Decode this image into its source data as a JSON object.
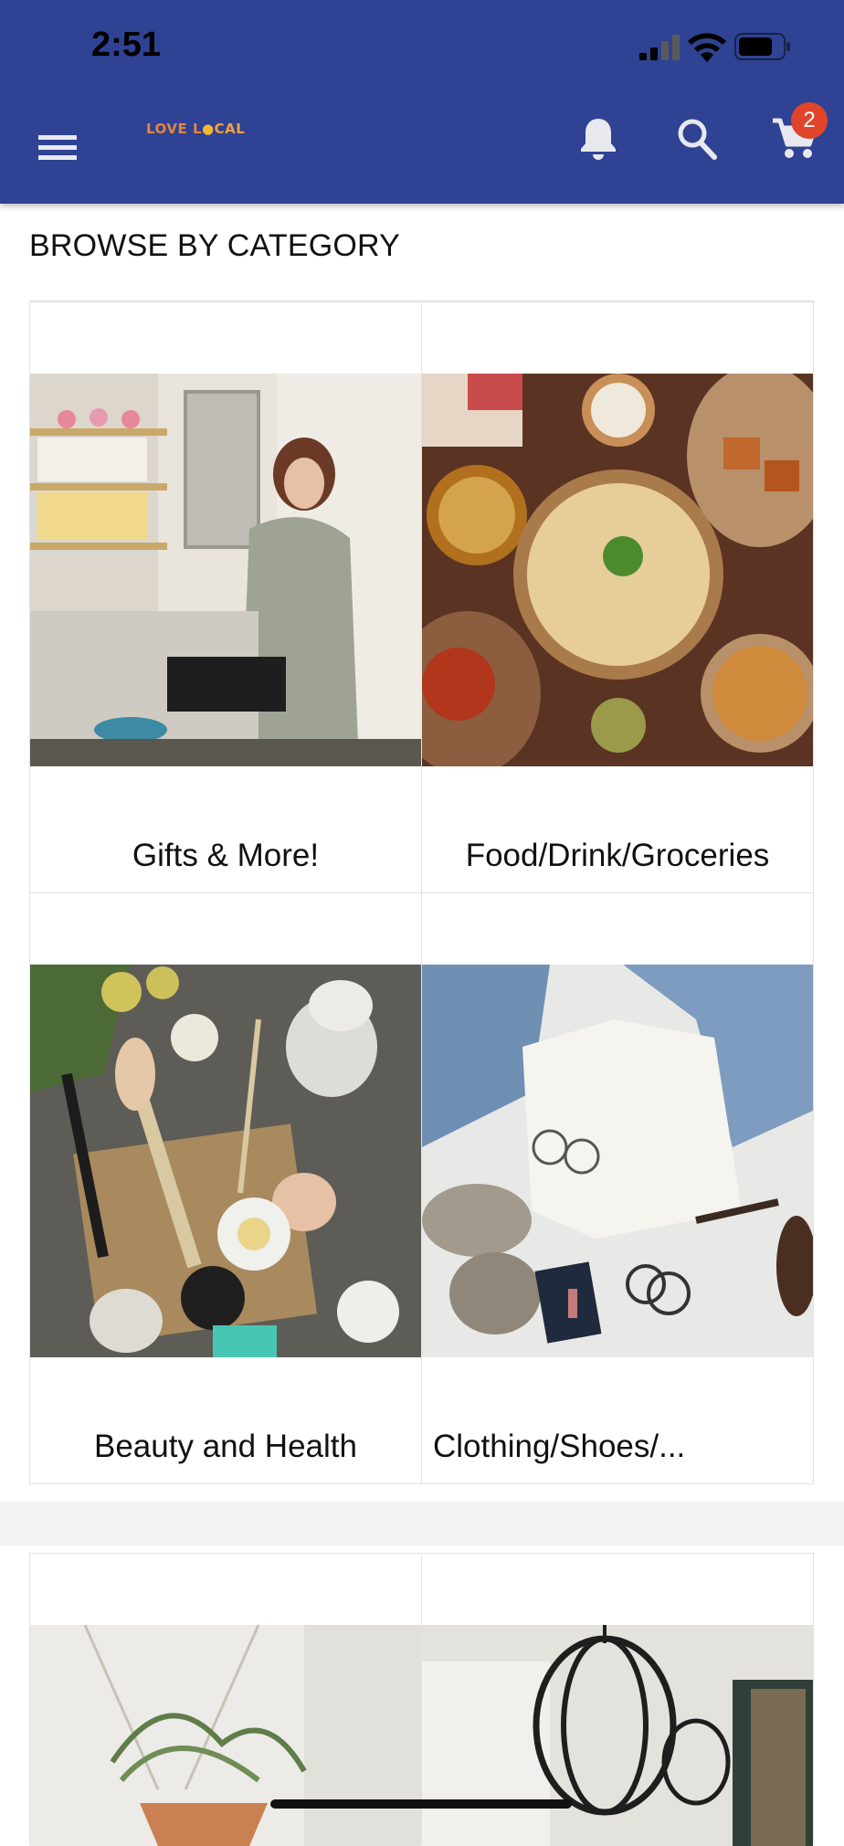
{
  "status_bar": {
    "time": "2:51"
  },
  "header": {
    "logo_text_left": "LOVE L",
    "logo_text_right": "CAL",
    "cart_count": "2"
  },
  "section": {
    "title": "BROWSE BY CATEGORY"
  },
  "categories": [
    {
      "label": "Gifts & More!"
    },
    {
      "label": "Food/Drink/Groceries"
    },
    {
      "label": "Beauty and Health"
    },
    {
      "label": "Clothing/Shoes/..."
    }
  ],
  "colors": {
    "header_bg": "#2f4293",
    "badge": "#e0452c",
    "logo": "#e8853a"
  },
  "icons": [
    "hamburger-menu-icon",
    "bell-icon",
    "search-icon",
    "cart-icon",
    "signal-icon",
    "wifi-icon",
    "battery-icon"
  ]
}
